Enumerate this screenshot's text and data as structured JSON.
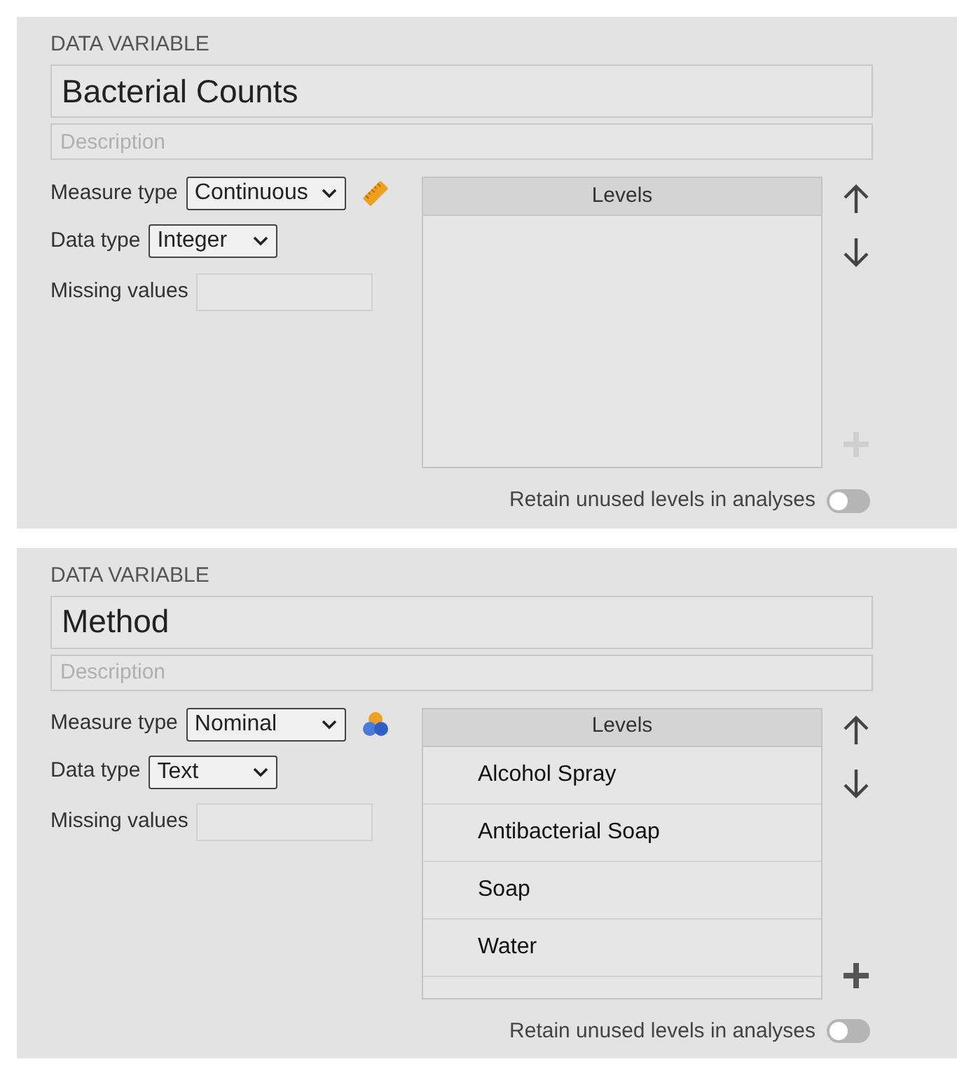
{
  "panels": [
    {
      "heading": "DATA VARIABLE",
      "name": "Bacterial Counts",
      "description": {
        "placeholder": "Description"
      },
      "measure_type": {
        "label": "Measure type",
        "value": "Continuous",
        "kind": "continuous"
      },
      "data_type": {
        "label": "Data type",
        "value": "Integer"
      },
      "missing_values": {
        "label": "Missing values"
      },
      "levels": {
        "heading": "Levels",
        "add_disabled": true
      },
      "retain": {
        "label": "Retain unused levels in analyses",
        "on": false
      }
    },
    {
      "heading": "DATA VARIABLE",
      "name": "Method",
      "description": {
        "placeholder": "Description"
      },
      "measure_type": {
        "label": "Measure type",
        "value": "Nominal",
        "kind": "nominal"
      },
      "data_type": {
        "label": "Data type",
        "value": "Text"
      },
      "missing_values": {
        "label": "Missing values"
      },
      "levels": {
        "heading": "Levels",
        "items": [
          "Alcohol Spray",
          "Antibacterial Soap",
          "Soap",
          "Water"
        ],
        "add_disabled": false
      },
      "retain": {
        "label": "Retain unused levels in analyses",
        "on": false
      }
    }
  ]
}
